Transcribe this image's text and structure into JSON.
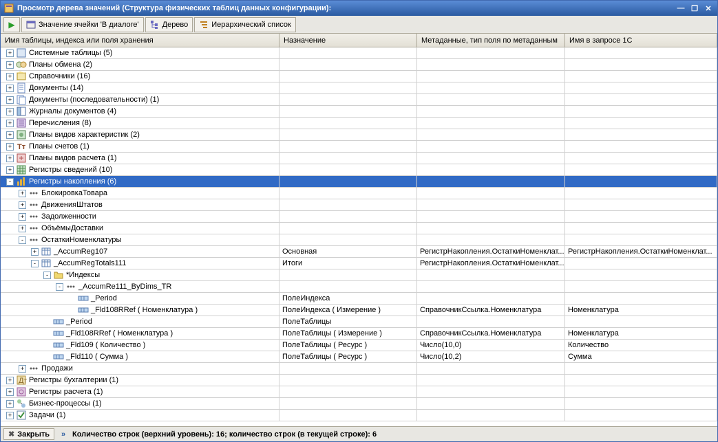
{
  "window": {
    "title": "Просмотр дерева значений (Структура физических таблиц данных конфигурации):"
  },
  "toolbar": {
    "cell_value": "Значение ячейки 'В диалоге'",
    "tree_btn": "Дерево",
    "hier_list": "Иерархический список"
  },
  "columns": {
    "c1": "Имя таблицы, индекса или поля хранения",
    "c2": "Назначение",
    "c3": "Метаданные, тип поля по метаданным",
    "c4": "Имя в запросе 1С"
  },
  "rows": [
    {
      "level": 0,
      "exp": "+",
      "icon": "sys",
      "label": "Системные таблицы (5)"
    },
    {
      "level": 0,
      "exp": "+",
      "icon": "exchange",
      "label": "Планы обмена (2)"
    },
    {
      "level": 0,
      "exp": "+",
      "icon": "catalog",
      "label": "Справочники (16)"
    },
    {
      "level": 0,
      "exp": "+",
      "icon": "doc",
      "label": "Документы (14)"
    },
    {
      "level": 0,
      "exp": "+",
      "icon": "docseq",
      "label": "Документы (последовательности) (1)"
    },
    {
      "level": 0,
      "exp": "+",
      "icon": "journal",
      "label": "Журналы документов (4)"
    },
    {
      "level": 0,
      "exp": "+",
      "icon": "enum",
      "label": "Перечисления (8)"
    },
    {
      "level": 0,
      "exp": "+",
      "icon": "char",
      "label": "Планы видов характеристик (2)"
    },
    {
      "level": 0,
      "exp": "+",
      "icon": "accplan",
      "label": "Планы счетов (1)"
    },
    {
      "level": 0,
      "exp": "+",
      "icon": "calcplan",
      "label": "Планы видов расчета (1)"
    },
    {
      "level": 0,
      "exp": "+",
      "icon": "inforeg",
      "label": "Регистры сведений (10)"
    },
    {
      "level": 0,
      "exp": "-",
      "icon": "accumreg",
      "label": "Регистры накопления (6)",
      "selected": true
    },
    {
      "level": 1,
      "exp": "+",
      "icon": "dots",
      "label": "БлокировкаТовара"
    },
    {
      "level": 1,
      "exp": "+",
      "icon": "dots",
      "label": "ДвиженияШтатов"
    },
    {
      "level": 1,
      "exp": "+",
      "icon": "dots",
      "label": "Задолженности"
    },
    {
      "level": 1,
      "exp": "+",
      "icon": "dots",
      "label": "ОбъёмыДоставки"
    },
    {
      "level": 1,
      "exp": "-",
      "icon": "dots",
      "label": "ОстаткиНоменклатуры"
    },
    {
      "level": 2,
      "exp": "+",
      "icon": "table",
      "label": "_AccumReg107",
      "c2": "Основная",
      "c3": "РегистрНакопления.ОстаткиНоменклат...",
      "c4": "РегистрНакопления.ОстаткиНоменклат..."
    },
    {
      "level": 2,
      "exp": "-",
      "icon": "table",
      "label": "_AccumRegTotals111",
      "c2": "Итоги",
      "c3": "РегистрНакопления.ОстаткиНоменклат..."
    },
    {
      "level": 3,
      "exp": "-",
      "icon": "folder",
      "label": "*Индексы"
    },
    {
      "level": 4,
      "exp": "-",
      "icon": "dots",
      "label": "_AccumRe111_ByDims_TR"
    },
    {
      "level": 5,
      "exp": "",
      "icon": "field",
      "label": "_Period",
      "c2": "ПолеИндекса"
    },
    {
      "level": 5,
      "exp": "",
      "icon": "field",
      "label": "_Fld108RRef ( Номенклатура )",
      "c2": "ПолеИндекса ( Измерение )",
      "c3": "СправочникСсылка.Номенклатура",
      "c4": "Номенклатура"
    },
    {
      "level": 3,
      "exp": "",
      "icon": "field",
      "label": "_Period",
      "c2": "ПолеТаблицы"
    },
    {
      "level": 3,
      "exp": "",
      "icon": "field",
      "label": "_Fld108RRef ( Номенклатура )",
      "c2": "ПолеТаблицы ( Измерение )",
      "c3": "СправочникСсылка.Номенклатура",
      "c4": "Номенклатура"
    },
    {
      "level": 3,
      "exp": "",
      "icon": "field",
      "label": "_Fld109 ( Количество )",
      "c2": "ПолеТаблицы ( Ресурс )",
      "c3": "Число(10,0)",
      "c4": "Количество"
    },
    {
      "level": 3,
      "exp": "",
      "icon": "field",
      "label": "_Fld110 ( Сумма )",
      "c2": "ПолеТаблицы ( Ресурс )",
      "c3": "Число(10,2)",
      "c4": "Сумма"
    },
    {
      "level": 1,
      "exp": "+",
      "icon": "dots",
      "label": "Продажи"
    },
    {
      "level": 0,
      "exp": "+",
      "icon": "accreg",
      "label": "Регистры бухгалтерии (1)"
    },
    {
      "level": 0,
      "exp": "+",
      "icon": "calcreg",
      "label": "Регистры расчета (1)"
    },
    {
      "level": 0,
      "exp": "+",
      "icon": "bp",
      "label": "Бизнес-процессы (1)"
    },
    {
      "level": 0,
      "exp": "+",
      "icon": "task",
      "label": "Задачи (1)"
    }
  ],
  "status": {
    "close": "Закрыть",
    "text": "Количество строк (верхний уровень): 16; количество строк (в текущей строке): 6"
  },
  "icons": {
    "play": "▶",
    "minimize": "—",
    "restore": "❐",
    "close": "✕",
    "closex": "✖"
  }
}
